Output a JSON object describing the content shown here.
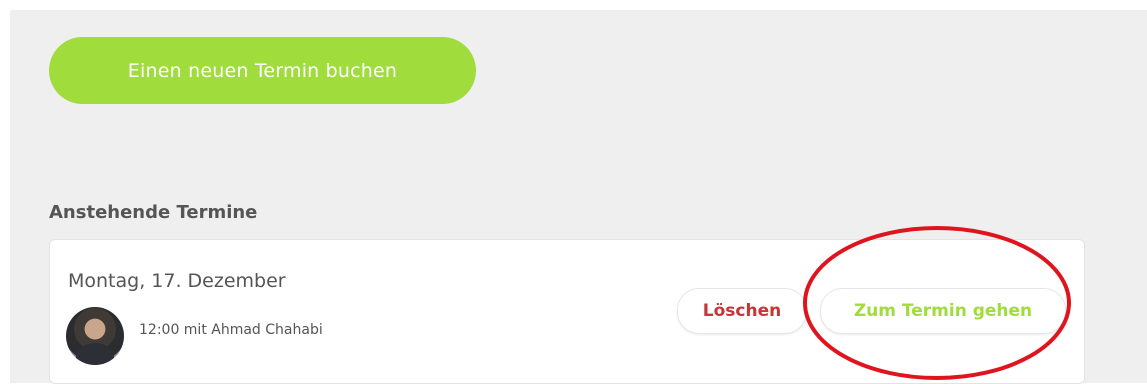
{
  "actions": {
    "book_new_label": "Einen neuen Termin buchen"
  },
  "upcoming": {
    "title": "Anstehende Termine",
    "appointments": [
      {
        "date": "Montag, 17. Dezember",
        "details": "12:00 mit Ahmad Chahabi",
        "delete_label": "Löschen",
        "goto_label": "Zum Termin gehen"
      }
    ]
  },
  "colors": {
    "accent_green": "#9fdc3c",
    "delete_red": "#c73535",
    "annotation_red": "#e0141e",
    "panel_background": "#efefef"
  }
}
